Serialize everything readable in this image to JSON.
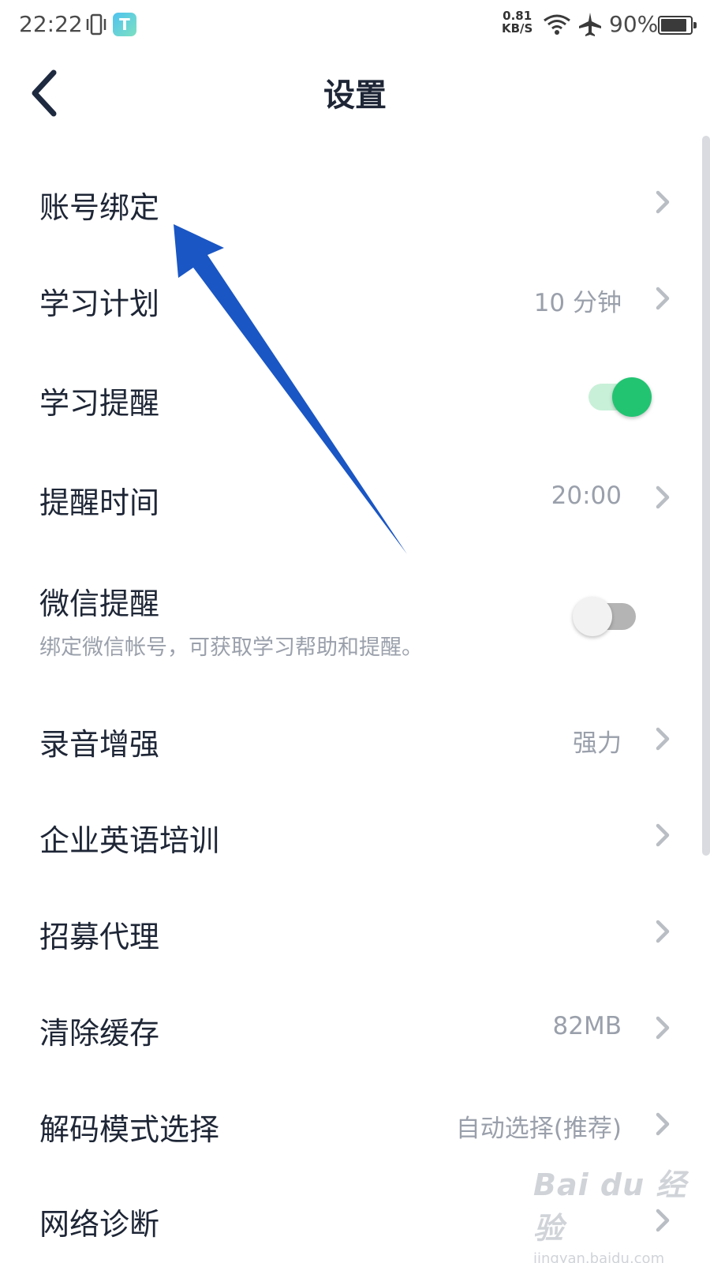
{
  "status_bar": {
    "time": "22:22",
    "app_icon_glyph": "T",
    "net_speed_value": "0.81",
    "net_speed_unit": "KB/S",
    "battery_percent": "90%",
    "battery_level": 0.9
  },
  "header": {
    "title": "设置",
    "back_icon": "chevron-left-icon"
  },
  "settings": {
    "items": [
      {
        "label": "账号绑定",
        "value": "",
        "control": "chevron"
      },
      {
        "label": "学习计划",
        "value": "10 分钟",
        "control": "chevron"
      },
      {
        "label": "学习提醒",
        "value": "",
        "control": "toggle",
        "toggle_on": true
      },
      {
        "label": "提醒时间",
        "value": "20:00",
        "control": "chevron"
      },
      {
        "label": "微信提醒",
        "subtitle": "绑定微信帐号，可获取学习帮助和提醒。",
        "control": "toggle",
        "toggle_on": false
      },
      {
        "label": "录音增强",
        "value": "强力",
        "control": "chevron"
      },
      {
        "label": "企业英语培训",
        "value": "",
        "control": "chevron"
      },
      {
        "label": "招募代理",
        "value": "",
        "control": "chevron"
      },
      {
        "label": "清除缓存",
        "value": "82MB",
        "control": "chevron"
      },
      {
        "label": "解码模式选择",
        "value": "自动选择(推荐)",
        "control": "chevron"
      },
      {
        "label": "网络诊断",
        "value": "",
        "control": "chevron"
      }
    ]
  },
  "colors": {
    "toggle_on_knob": "#22c472",
    "toggle_on_track": "#c8f0d8",
    "toggle_off_knob": "#f2f2f2",
    "toggle_off_track": "#b4b4b4",
    "annotation_arrow": "#1a56c4",
    "chevron": "#b9bdc4"
  },
  "watermark": {
    "logo": "Bai du 经验",
    "url": "jingyan.baidu.com"
  }
}
